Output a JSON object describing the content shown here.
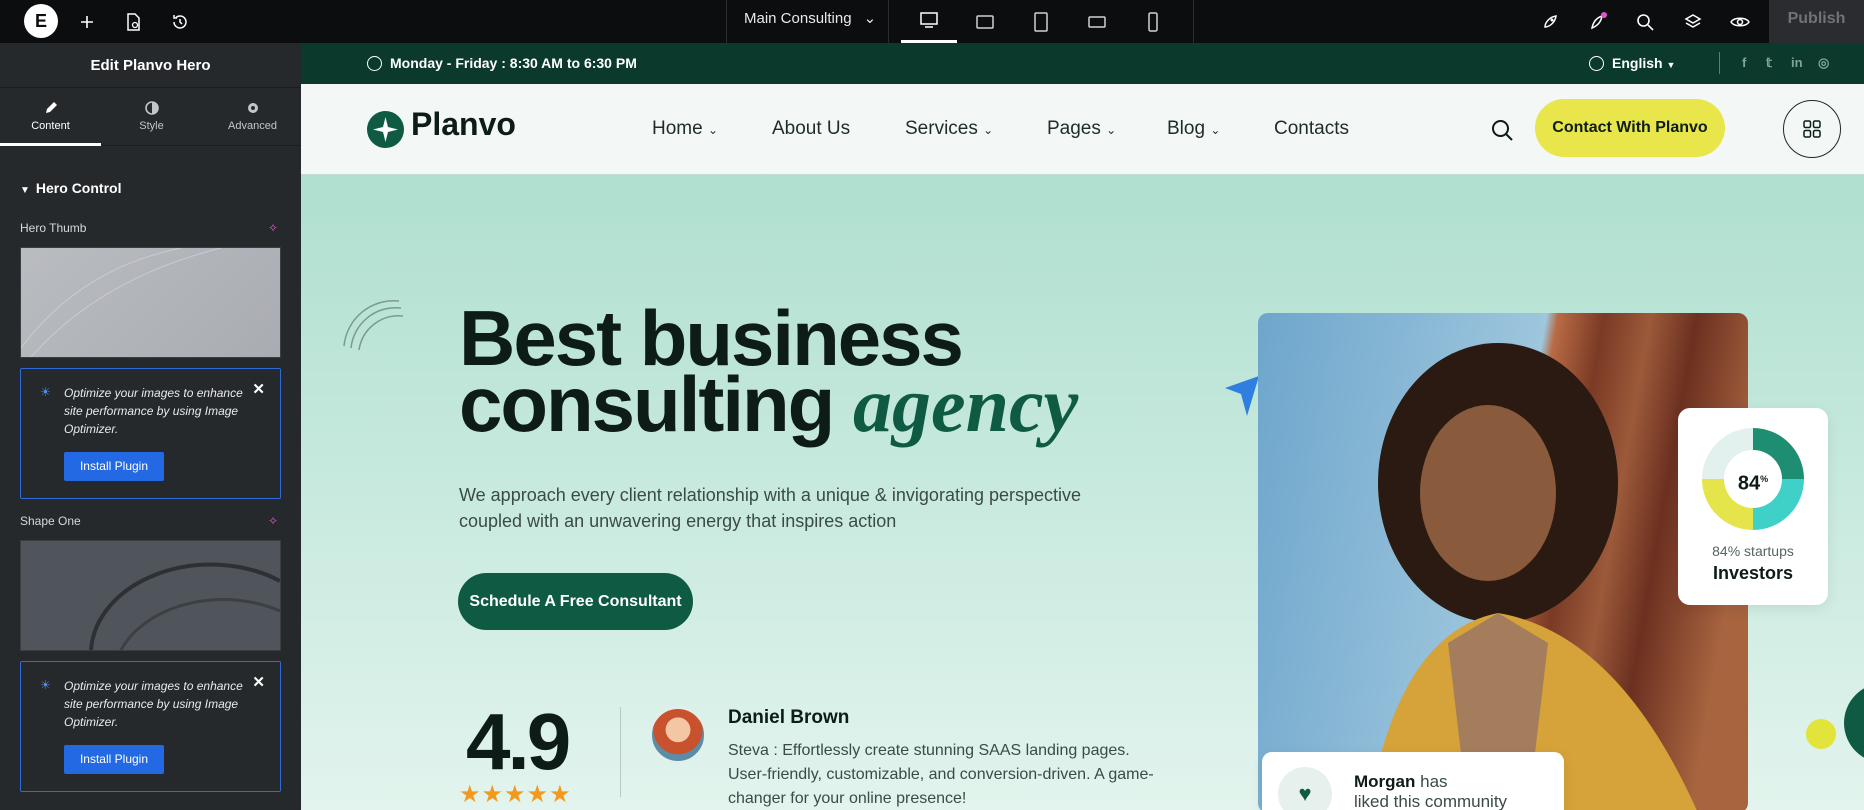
{
  "editor": {
    "doc_title": "Main Consulting",
    "publish_label": "Publish",
    "panel_title": "Edit Planvo Hero",
    "tabs": [
      {
        "label": "Content"
      },
      {
        "label": "Style"
      },
      {
        "label": "Advanced"
      }
    ],
    "section_title": "Hero Control",
    "field1_label": "Hero Thumb",
    "field2_label": "Shape One",
    "notice_text": "Optimize your images to enhance site performance by using Image Optimizer.",
    "install_label": "Install Plugin"
  },
  "site": {
    "hours": "Monday - Friday : 8:30 AM to 6:30 PM",
    "language": "English",
    "logo_text": "Planvo",
    "nav": [
      "Home",
      "About Us",
      "Services",
      "Pages",
      "Blog",
      "Contacts"
    ],
    "cta_label": "Contact With Planvo",
    "hero_line1": "Best business",
    "hero_line2": "consulting",
    "hero_emph": "agency",
    "hero_desc": "We approach every client relationship with a unique & invigorating perspective coupled with an unwavering energy that inspires action",
    "hero_button": "Schedule A Free Consultant",
    "rating": "4.9",
    "stars": "★★★★★",
    "testimonial_name": "Daniel Brown",
    "testimonial_text": "Steva : Effortlessly create stunning SAAS landing pages. User-friendly, customizable, and conversion-driven. A game-changer for your online presence!",
    "stat_value": "84",
    "stat_unit": "%",
    "stat_line1": "84% startups",
    "stat_line2": "Investors",
    "morgan_name": "Morgan",
    "morgan_text1": "has",
    "morgan_text2": "liked this community"
  },
  "colors": {
    "brand_green": "#0e5a43",
    "accent_yellow": "#e8e64b",
    "editor_blue": "#2469e4"
  }
}
